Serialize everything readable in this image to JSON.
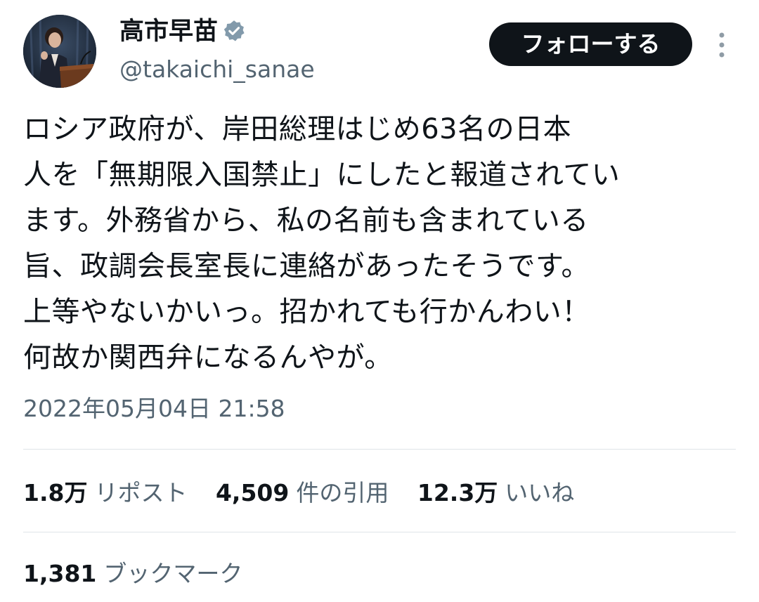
{
  "author": {
    "display_name": "高市早苗",
    "handle": "@takaichi_sanae",
    "avatar_icon": "profile-photo",
    "verified_icon": "verified-badge-icon",
    "verified_color": "#829aab"
  },
  "actions": {
    "follow_label": "フォローする",
    "more_icon": "more-vertical-icon"
  },
  "tweet": {
    "text_lines": [
      "ロシア政府が、岸田総理はじめ63名の日本",
      "人を「無期限入国禁止」にしたと報道されてい",
      "ます。外務省から、私の名前も含まれている",
      "旨、政調会長室長に連絡があったそうです。",
      "上等やないかいっ。招かれても行かんわい！",
      "何故か関西弁になるんやが。"
    ],
    "timestamp": "2022年05月04日 21:58"
  },
  "stats": {
    "reposts": {
      "count": "1.8万",
      "label": "リポスト"
    },
    "quotes": {
      "count": "4,509",
      "label": "件の引用"
    },
    "likes": {
      "count": "12.3万",
      "label": "いいね"
    },
    "bookmarks": {
      "count": "1,381",
      "label": "ブックマーク"
    }
  },
  "colors": {
    "text_primary": "#0f1419",
    "text_secondary": "#536471",
    "button_bg": "#0f1419",
    "divider": "#dfe4e8"
  }
}
